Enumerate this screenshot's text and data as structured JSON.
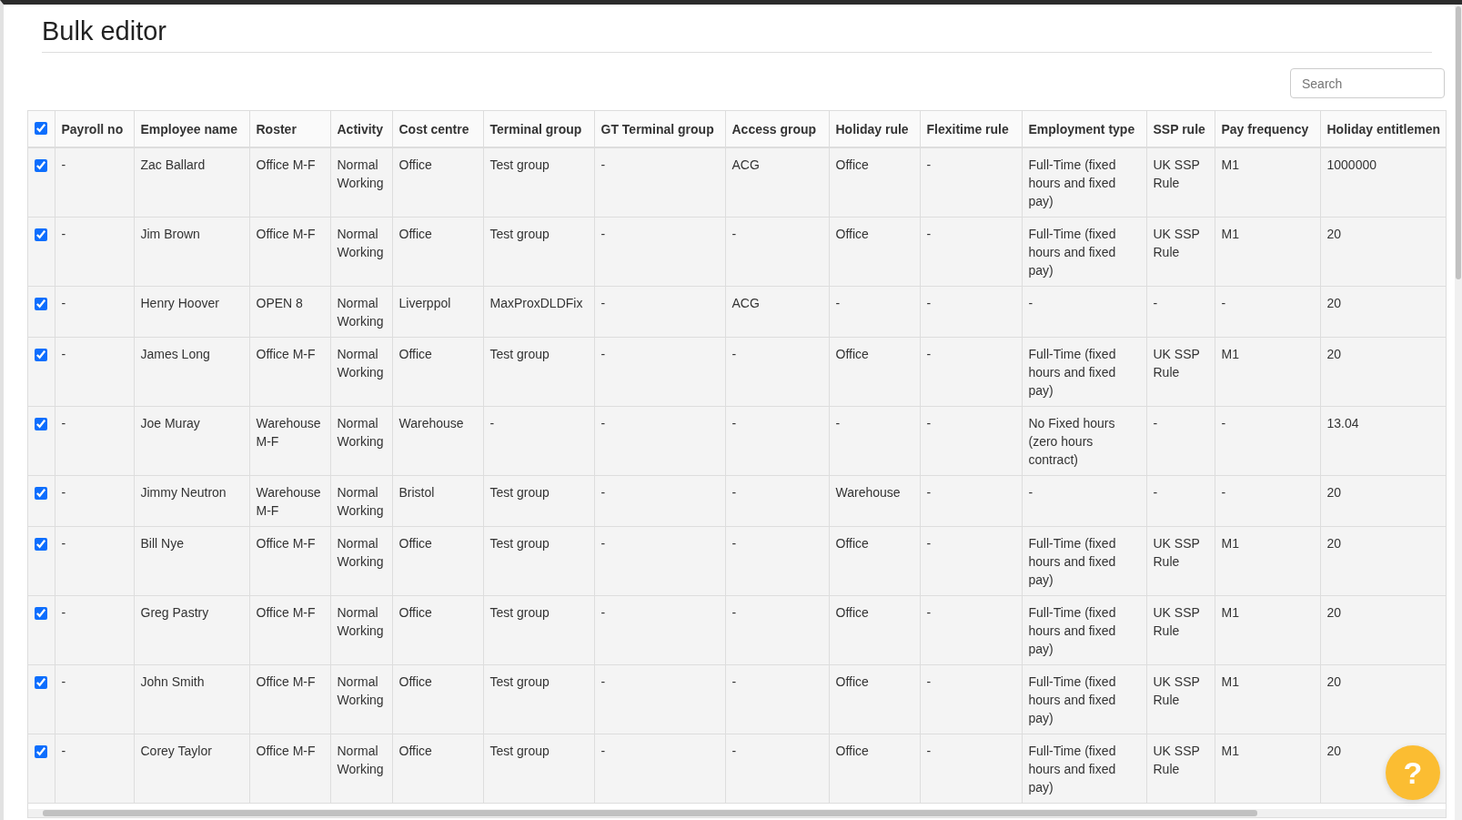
{
  "title": "Bulk editor",
  "search": {
    "placeholder": "Search"
  },
  "table": {
    "select_all": {
      "checked": true
    },
    "columns": [
      "Payroll no",
      "Employee name",
      "Roster",
      "Activity",
      "Cost centre",
      "Terminal group",
      "GT Terminal group",
      "Access group",
      "Holiday rule",
      "Flexitime rule",
      "Employment type",
      "SSP rule",
      "Pay frequency",
      "Holiday entitlemen"
    ],
    "rows": [
      {
        "selected": true,
        "cells": [
          "-",
          "Zac Ballard",
          "Office M-F",
          "Normal Working",
          "Office",
          "Test group",
          "-",
          "ACG",
          "Office",
          "-",
          "Full-Time (fixed hours and fixed pay)",
          "UK SSP Rule",
          "M1",
          "1000000"
        ]
      },
      {
        "selected": true,
        "cells": [
          "-",
          "Jim Brown",
          "Office M-F",
          "Normal Working",
          "Office",
          "Test group",
          "-",
          "-",
          "Office",
          "-",
          "Full-Time (fixed hours and fixed pay)",
          "UK SSP Rule",
          "M1",
          "20"
        ]
      },
      {
        "selected": true,
        "cells": [
          "-",
          "Henry Hoover",
          "OPEN 8",
          "Normal Working",
          "Liverppol",
          "MaxProxDLDFix",
          "-",
          "ACG",
          "-",
          "-",
          "-",
          "-",
          "-",
          "20"
        ]
      },
      {
        "selected": true,
        "cells": [
          "-",
          "James Long",
          "Office M-F",
          "Normal Working",
          "Office",
          "Test group",
          "-",
          "-",
          "Office",
          "-",
          "Full-Time (fixed hours and fixed pay)",
          "UK SSP Rule",
          "M1",
          "20"
        ]
      },
      {
        "selected": true,
        "cells": [
          "-",
          "Joe Muray",
          "Warehouse M-F",
          "Normal Working",
          "Warehouse",
          "-",
          "-",
          "-",
          "-",
          "-",
          "No Fixed hours (zero hours contract)",
          "-",
          "-",
          "13.04"
        ]
      },
      {
        "selected": true,
        "cells": [
          "-",
          "Jimmy Neutron",
          "Warehouse M-F",
          "Normal Working",
          "Bristol",
          "Test group",
          "-",
          "-",
          "Warehouse",
          "-",
          "-",
          "-",
          "-",
          "20"
        ]
      },
      {
        "selected": true,
        "cells": [
          "-",
          "Bill Nye",
          "Office M-F",
          "Normal Working",
          "Office",
          "Test group",
          "-",
          "-",
          "Office",
          "-",
          "Full-Time (fixed hours and fixed pay)",
          "UK SSP Rule",
          "M1",
          "20"
        ]
      },
      {
        "selected": true,
        "cells": [
          "-",
          "Greg Pastry",
          "Office M-F",
          "Normal Working",
          "Office",
          "Test group",
          "-",
          "-",
          "Office",
          "-",
          "Full-Time (fixed hours and fixed pay)",
          "UK SSP Rule",
          "M1",
          "20"
        ]
      },
      {
        "selected": true,
        "cells": [
          "-",
          "John Smith",
          "Office M-F",
          "Normal Working",
          "Office",
          "Test group",
          "-",
          "-",
          "Office",
          "-",
          "Full-Time (fixed hours and fixed pay)",
          "UK SSP Rule",
          "M1",
          "20"
        ]
      },
      {
        "selected": true,
        "cells": [
          "-",
          "Corey Taylor",
          "Office M-F",
          "Normal Working",
          "Office",
          "Test group",
          "-",
          "-",
          "Office",
          "-",
          "Full-Time (fixed hours and fixed pay)",
          "UK SSP Rule",
          "M1",
          "20"
        ]
      }
    ]
  },
  "help_button": {
    "label": "?"
  }
}
